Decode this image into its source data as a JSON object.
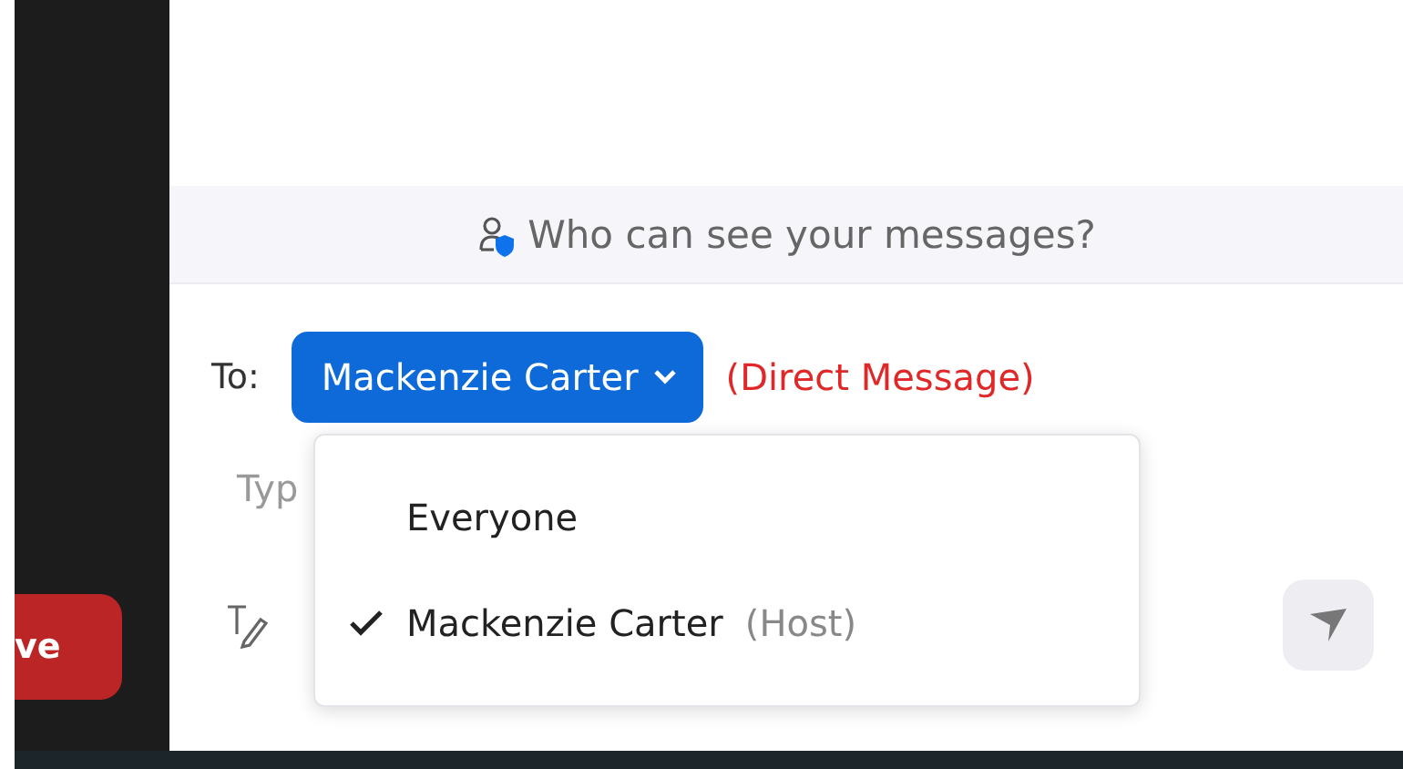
{
  "side_button": {
    "label": "ve"
  },
  "notice": {
    "text": "Who can see your messages?"
  },
  "recipient": {
    "label": "To:",
    "value": "Mackenzie Carter",
    "note": "(Direct Message)"
  },
  "message_input": {
    "placeholder": "Typ"
  },
  "recipient_menu": {
    "items": [
      {
        "label": "Everyone",
        "selected": false
      },
      {
        "label": "Mackenzie Carter",
        "suffix": "(Host)",
        "selected": true
      }
    ]
  }
}
